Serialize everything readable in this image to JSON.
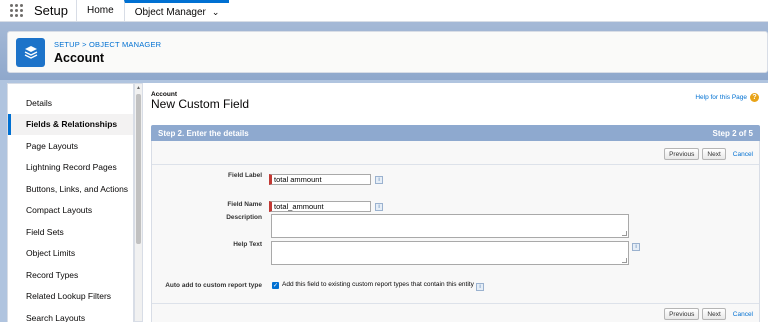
{
  "topnav": {
    "app_name": "Setup",
    "tabs": [
      {
        "label": "Home"
      },
      {
        "label": "Object Manager"
      }
    ]
  },
  "header": {
    "breadcrumb": "SETUP > OBJECT MANAGER",
    "title": "Account"
  },
  "sidebar": {
    "items": [
      {
        "label": "Details"
      },
      {
        "label": "Fields & Relationships"
      },
      {
        "label": "Page Layouts"
      },
      {
        "label": "Lightning Record Pages"
      },
      {
        "label": "Buttons, Links, and Actions"
      },
      {
        "label": "Compact Layouts"
      },
      {
        "label": "Field Sets"
      },
      {
        "label": "Object Limits"
      },
      {
        "label": "Record Types"
      },
      {
        "label": "Related Lookup Filters"
      },
      {
        "label": "Search Layouts"
      }
    ],
    "active_index": 1
  },
  "main": {
    "object_label": "Account",
    "page_title": "New Custom Field",
    "help_link": "Help for this Page",
    "step_title": "Step 2. Enter the details",
    "step_count": "Step 2 of 5",
    "buttons": {
      "previous": "Previous",
      "next": "Next",
      "cancel": "Cancel"
    },
    "form": {
      "field_label_label": "Field Label",
      "field_label_value": "total ammount",
      "field_name_label": "Field Name",
      "field_name_value": "total_ammount",
      "description_label": "Description",
      "help_text_label": "Help Text",
      "auto_add_label": "Auto add to custom report type",
      "auto_add_checked": true,
      "auto_add_text": "Add this field to existing custom report types that contain this entity"
    }
  },
  "colors": {
    "accent": "#0070d2",
    "step_bar": "#8ea9cf",
    "required_marker": "#c23934",
    "help_icon": "#e8a317"
  }
}
